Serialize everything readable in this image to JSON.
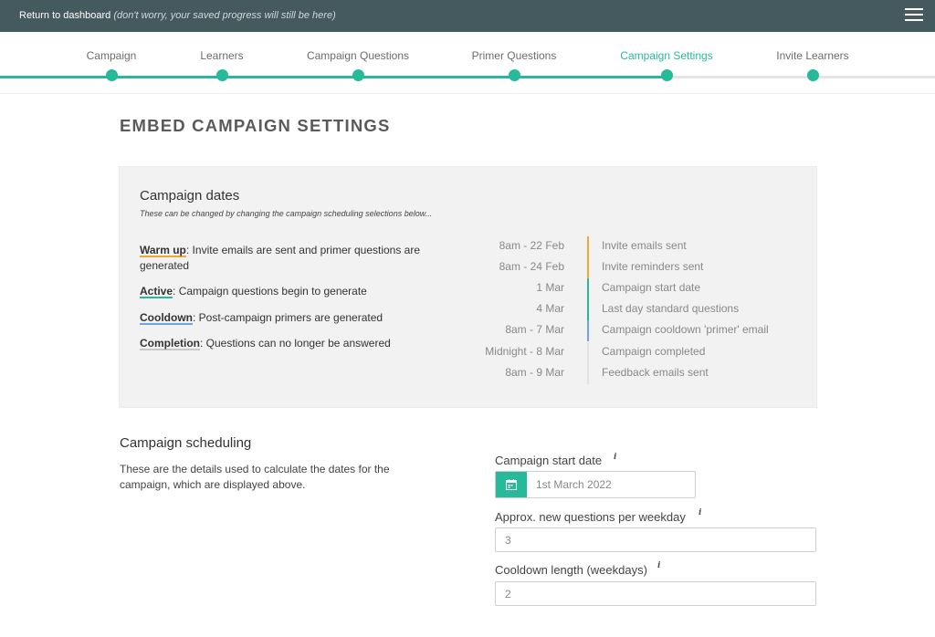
{
  "topbar": {
    "return_label": "Return to dashboard",
    "return_note": "(don't worry, your saved progress will still be here)",
    "menu_icon": "hamburger-icon"
  },
  "steps": [
    {
      "label": "Campaign",
      "state": "done"
    },
    {
      "label": "Learners",
      "state": "done"
    },
    {
      "label": "Campaign Questions",
      "state": "done"
    },
    {
      "label": "Primer Questions",
      "state": "done"
    },
    {
      "label": "Campaign Settings",
      "state": "current"
    },
    {
      "label": "Invite Learners",
      "state": "todo"
    }
  ],
  "page_title": "EMBED CAMPAIGN SETTINGS",
  "dates_panel": {
    "title": "Campaign dates",
    "subtitle": "These can be changed by changing the campaign scheduling selections below...",
    "phases": [
      {
        "name": "Warm up",
        "desc": ": Invite emails are sent and primer questions are generated"
      },
      {
        "name": "Active",
        "desc": ": Campaign questions begin to generate"
      },
      {
        "name": "Cooldown",
        "desc": ": Post-campaign primers are generated"
      },
      {
        "name": "Completion",
        "desc": ": Questions can no longer be answered"
      }
    ],
    "timeline": [
      {
        "time": "8am - 22 Feb",
        "event": "Invite emails sent",
        "color": "#f0a830"
      },
      {
        "time": "8am - 24 Feb",
        "event": "Invite reminders sent",
        "color": "#f0a830"
      },
      {
        "time": "1 Mar",
        "event": "Campaign start date",
        "color": "#26b99a"
      },
      {
        "time": "4 Mar",
        "event": "Last day standard questions",
        "color": "#26b99a"
      },
      {
        "time": "8am - 7 Mar",
        "event": "Campaign cooldown 'primer' email",
        "color": "#6ea3e6"
      },
      {
        "time": "Midnight - 8 Mar",
        "event": "Campaign completed",
        "color": "#e2e2e2"
      },
      {
        "time": "8am - 9 Mar",
        "event": "Feedback emails sent",
        "color": "#e2e2e2"
      }
    ]
  },
  "scheduling": {
    "title": "Campaign scheduling",
    "description": "These are the details used to calculate the dates for the campaign, which are displayed above.",
    "start_date": {
      "label": "Campaign start date",
      "value": "1st March 2022"
    },
    "questions_per_weekday": {
      "label": "Approx. new questions per weekday",
      "value": "3"
    },
    "cooldown_length": {
      "label": "Cooldown length (weekdays)",
      "value": "2"
    }
  },
  "colors": {
    "accent": "#26b99a",
    "topbar": "#455a5f",
    "warm_up": "#f0a830",
    "active": "#26b99a",
    "cooldown": "#6ea3e6",
    "completion": "#e2e2e2"
  }
}
